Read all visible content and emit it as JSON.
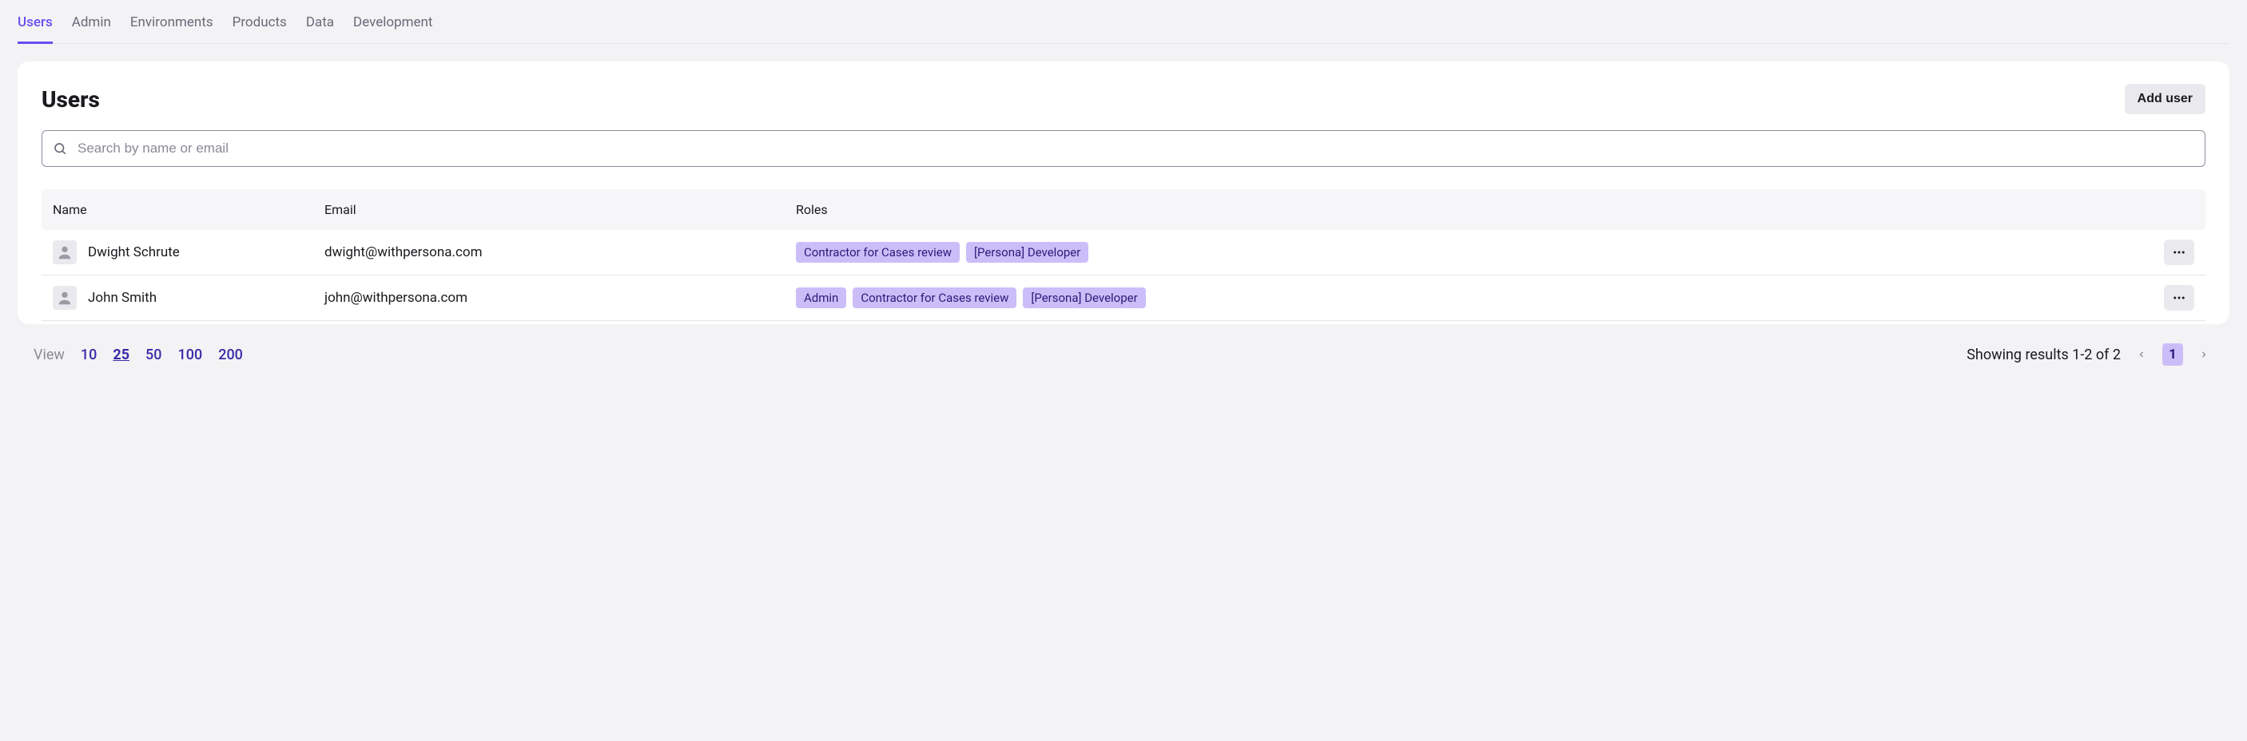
{
  "nav": {
    "tabs": [
      {
        "label": "Users",
        "active": true
      },
      {
        "label": "Admin",
        "active": false
      },
      {
        "label": "Environments",
        "active": false
      },
      {
        "label": "Products",
        "active": false
      },
      {
        "label": "Data",
        "active": false
      },
      {
        "label": "Development",
        "active": false
      }
    ]
  },
  "header": {
    "title": "Users",
    "add_button": "Add user"
  },
  "search": {
    "placeholder": "Search by name or email",
    "value": ""
  },
  "table": {
    "columns": [
      "Name",
      "Email",
      "Roles"
    ],
    "rows": [
      {
        "name": "Dwight Schrute",
        "email": "dwight@withpersona.com",
        "roles": [
          "Contractor for Cases review",
          "[Persona] Developer"
        ]
      },
      {
        "name": "John Smith",
        "email": "john@withpersona.com",
        "roles": [
          "Admin",
          "Contractor for Cases review",
          "[Persona] Developer"
        ]
      }
    ]
  },
  "footer": {
    "view_label": "View",
    "page_sizes": [
      10,
      25,
      50,
      100,
      200
    ],
    "active_page_size": 25,
    "results_text": "Showing results 1-2 of 2",
    "current_page": 1
  }
}
